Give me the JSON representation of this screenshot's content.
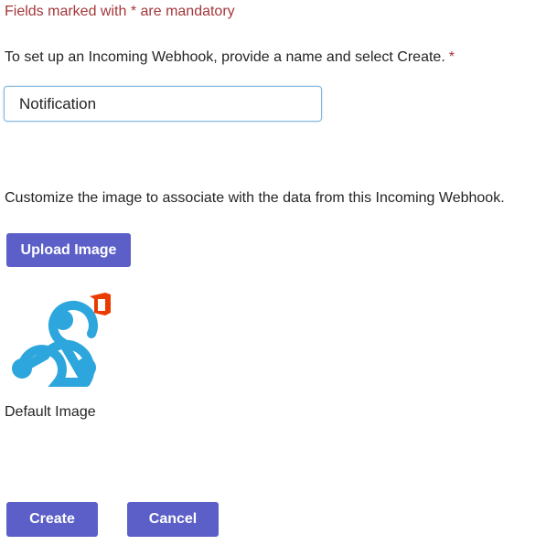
{
  "form": {
    "mandatory_note": "Fields marked with * are mandatory",
    "name_prompt": "To set up an Incoming Webhook, provide a name and select Create.",
    "required_marker": "*",
    "name_value": "Notification",
    "image_prompt": "Customize the image to associate with the data from this Incoming Webhook.",
    "upload_label": "Upload Image",
    "image_icon": "webhook-icon",
    "office_badge_icon": "office-logo-icon",
    "image_caption": "Default Image",
    "create_label": "Create",
    "cancel_label": "Cancel"
  },
  "colors": {
    "accent": "#5b5fc7",
    "required_text": "#a4373a",
    "webhook_blue": "#2ca6dc",
    "office_red": "#eb3c00"
  }
}
